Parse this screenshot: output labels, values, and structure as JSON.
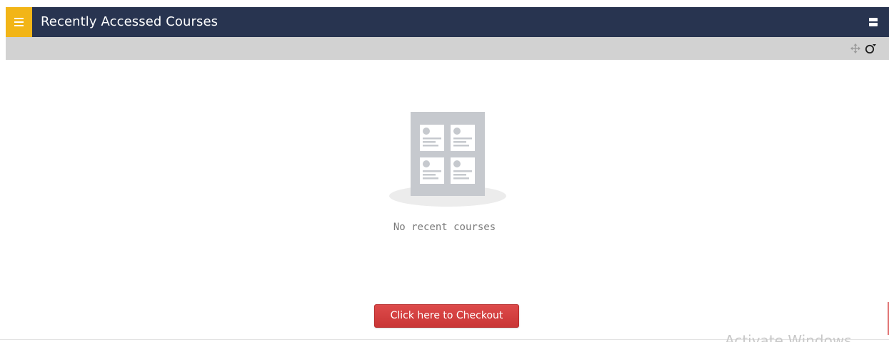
{
  "header": {
    "title": "Recently Accessed Courses",
    "menu_icon": "hamburger-icon",
    "collapse_icon": "collapse-icon",
    "background": "#283450",
    "accent": "#f2b517"
  },
  "action_bar": {
    "icons": [
      "move-icon",
      "gear-icon"
    ],
    "background": "#d2d2d2"
  },
  "content": {
    "empty_message": "No recent courses",
    "illustration_icon": "courses-placeholder-icon"
  },
  "checkout": {
    "label": "Click here to Checkout",
    "color": "#d43f3f"
  },
  "watermark": {
    "text": "Activate Windows"
  }
}
